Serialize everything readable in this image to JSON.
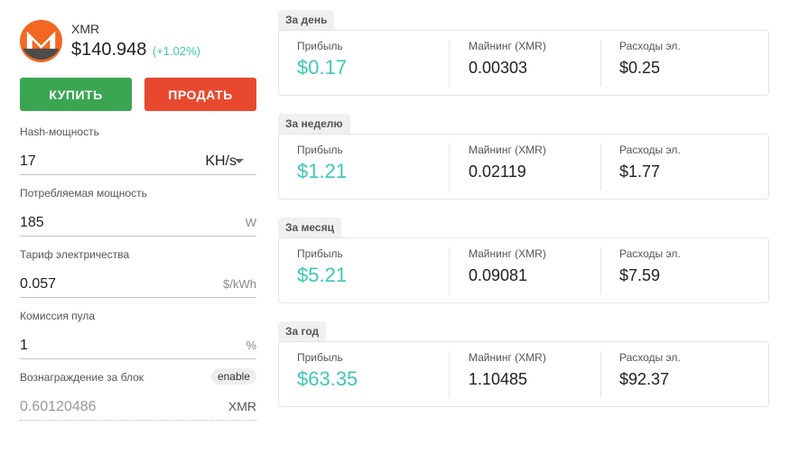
{
  "coin": {
    "ticker": "XMR",
    "price": "$140.948",
    "change": "(+1.02%)",
    "logo_icon": "monero-logo-icon"
  },
  "actions": {
    "buy_label": "КУПИТЬ",
    "sell_label": "ПРОДАТЬ"
  },
  "fields": {
    "hashrate": {
      "label": "Hash-мощность",
      "value": "17",
      "unit": "KH/s"
    },
    "power": {
      "label": "Потребляемая мощность",
      "value": "185",
      "unit": "W"
    },
    "tariff": {
      "label": "Тариф электричества",
      "value": "0.057",
      "unit": "$/kWh"
    },
    "pool_fee": {
      "label": "Комиссия пула",
      "value": "1",
      "unit": "%"
    },
    "block_reward": {
      "label": "Вознаграждение за блок",
      "toggle": "enable",
      "value": "0.60120486",
      "unit": "XMR"
    }
  },
  "results": {
    "labels": {
      "profit": "Прибыль",
      "mining": "Майнинг (XMR)",
      "costs": "Расходы эл."
    },
    "day": {
      "title": "За день",
      "profit": "$0.17",
      "mining": "0.00303",
      "costs": "$0.25"
    },
    "week": {
      "title": "За неделю",
      "profit": "$1.21",
      "mining": "0.02119",
      "costs": "$1.77"
    },
    "month": {
      "title": "За месяц",
      "profit": "$5.21",
      "mining": "0.09081",
      "costs": "$7.59"
    },
    "year": {
      "title": "За год",
      "profit": "$63.35",
      "mining": "1.10485",
      "costs": "$92.37"
    }
  },
  "colors": {
    "buy": "#3aa651",
    "sell": "#e8492e",
    "profit": "#3dc9b8",
    "monero_orange": "#f26822"
  }
}
